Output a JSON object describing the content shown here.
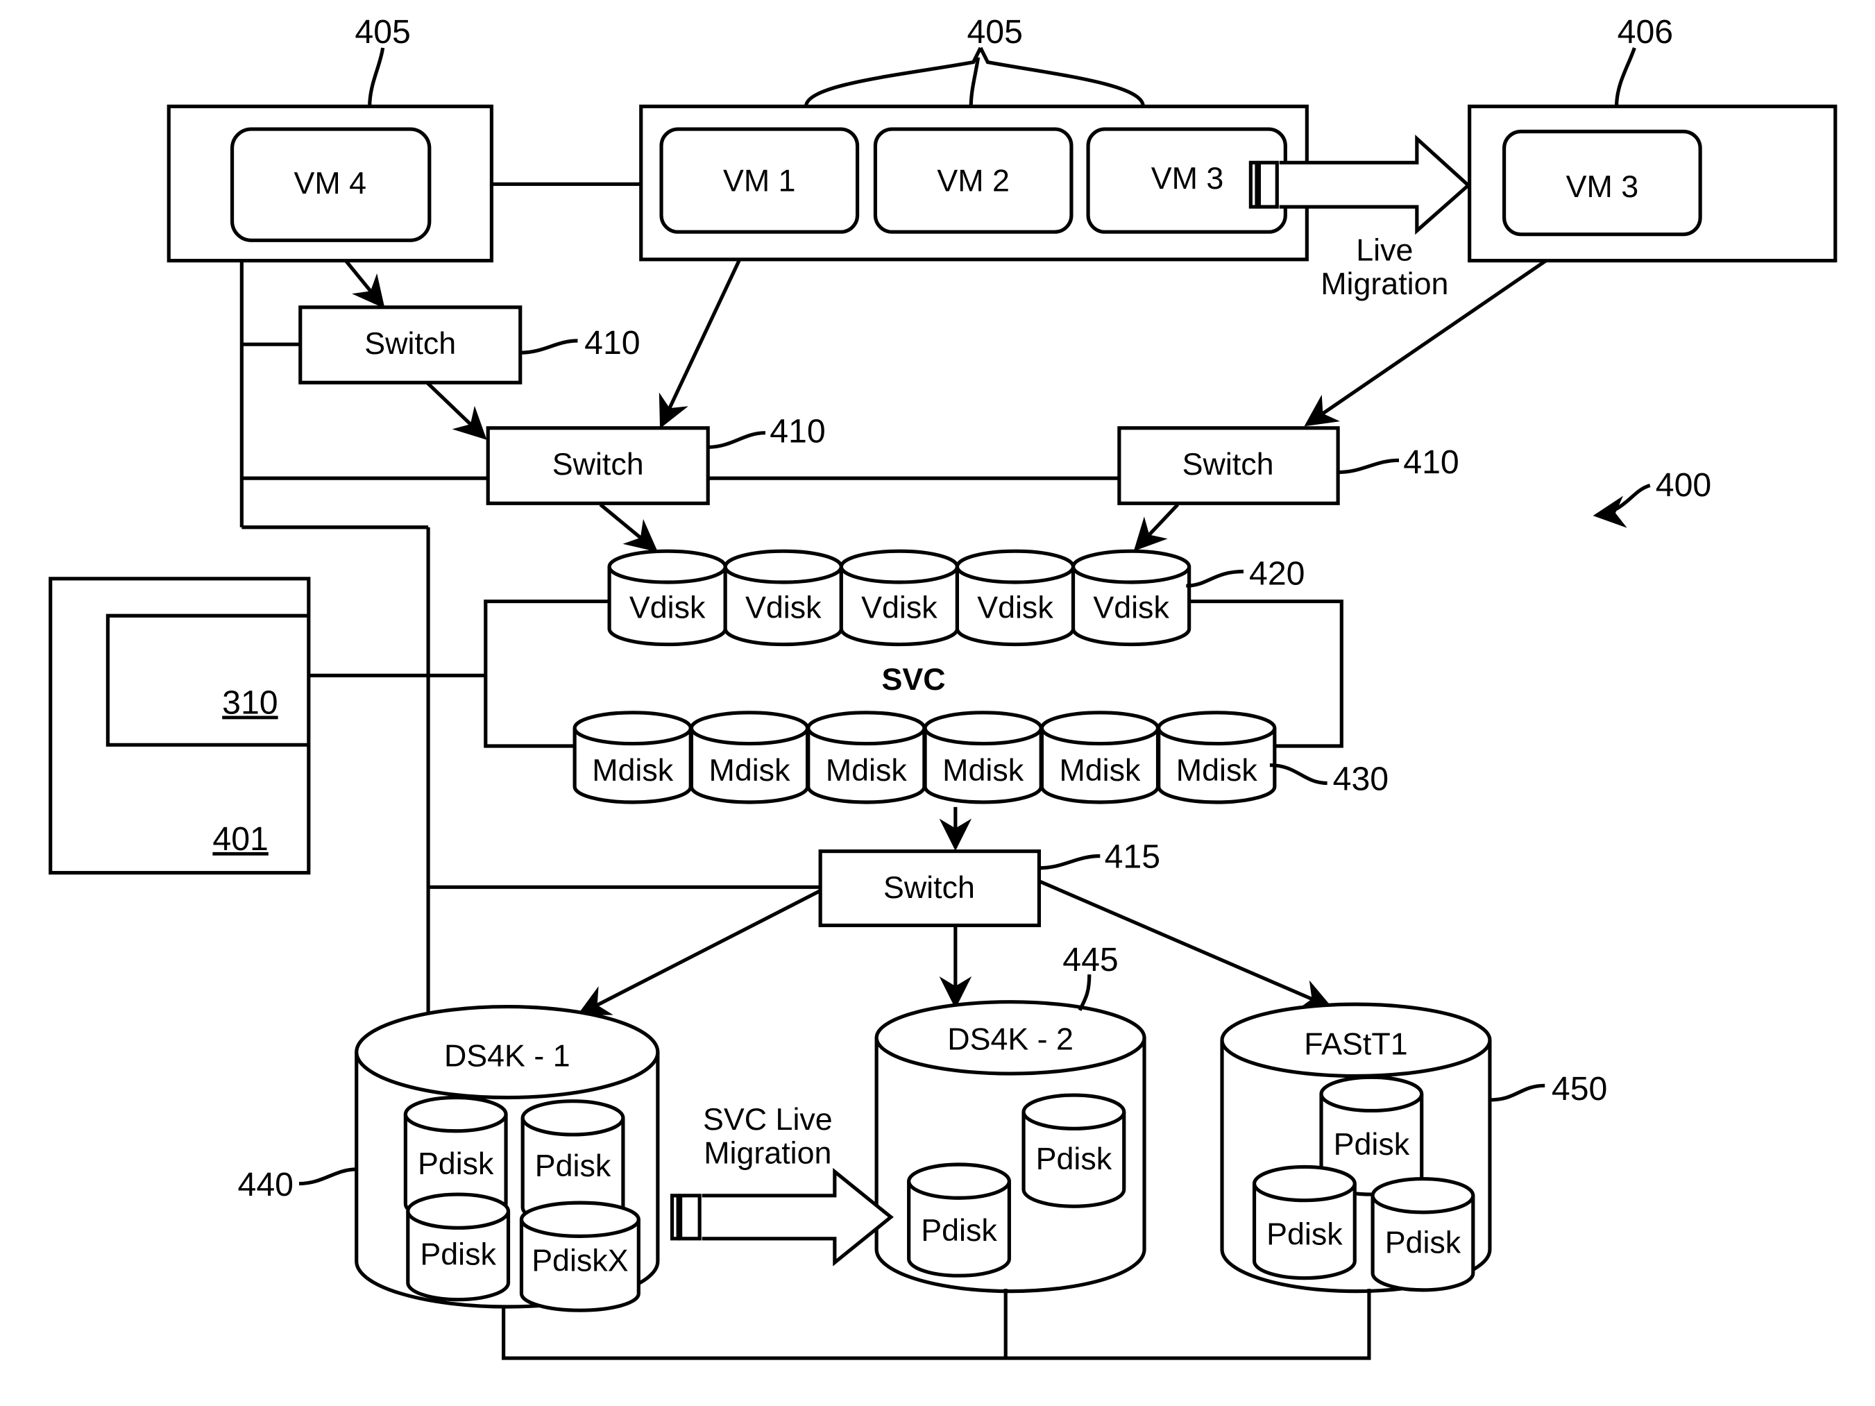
{
  "figure": {
    "reference": "400",
    "hosts": {
      "left_host": {
        "ref": "405",
        "vms": [
          "VM 4"
        ]
      },
      "center_host": {
        "ref": "405",
        "vms": [
          "VM 1",
          "VM 2",
          "VM 3"
        ]
      },
      "right_host": {
        "ref": "406",
        "vms": [
          "VM 3"
        ]
      }
    },
    "live_migration_label": [
      "Live",
      "Migration"
    ],
    "switches": [
      {
        "label": "Switch",
        "ref": "410"
      },
      {
        "label": "Switch",
        "ref": "410"
      },
      {
        "label": "Switch",
        "ref": "410"
      },
      {
        "label": "Switch",
        "ref": "415"
      }
    ],
    "controller": {
      "ref": "401",
      "component_ref": "310"
    },
    "svc": {
      "label": "SVC",
      "vdisks": {
        "ref": "420",
        "items": [
          "Vdisk",
          "Vdisk",
          "Vdisk",
          "Vdisk",
          "Vdisk"
        ]
      },
      "mdisks": {
        "ref": "430",
        "items": [
          "Mdisk",
          "Mdisk",
          "Mdisk",
          "Mdisk",
          "Mdisk",
          "Mdisk"
        ]
      }
    },
    "storage": [
      {
        "label": "DS4K - 1",
        "ref": "440",
        "pdisks": [
          "Pdisk",
          "Pdisk",
          "Pdisk",
          "PdiskX"
        ]
      },
      {
        "label": "DS4K - 2",
        "ref": "445",
        "pdisks": [
          "Pdisk",
          "Pdisk"
        ]
      },
      {
        "label": "FAStT1",
        "ref": "450",
        "pdisks": [
          "Pdisk",
          "Pdisk",
          "Pdisk"
        ]
      }
    ],
    "svc_live_migration_label": [
      "SVC Live",
      "Migration"
    ]
  }
}
